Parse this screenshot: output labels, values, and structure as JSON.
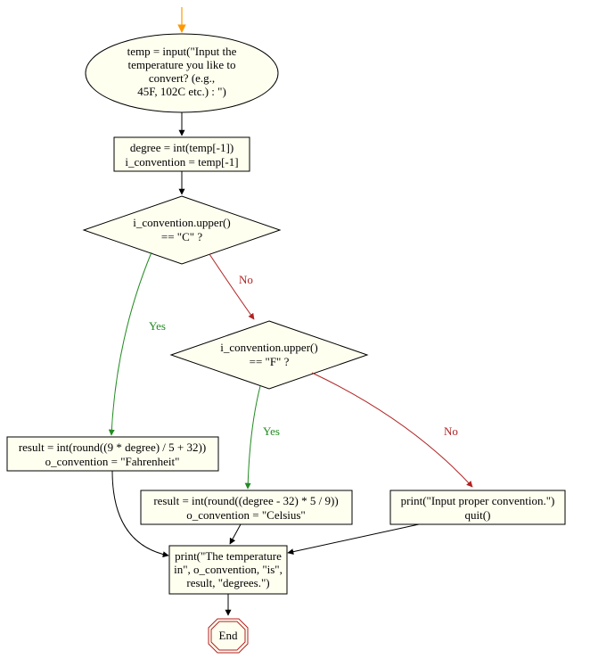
{
  "chart_data": {
    "type": "flowchart",
    "nodes": [
      {
        "id": "start",
        "shape": "point"
      },
      {
        "id": "n1",
        "shape": "ellipse",
        "text": [
          "temp = input(\"Input the",
          "temperature you like to",
          "convert? (e.g.,",
          "45F, 102C etc.) : \")"
        ]
      },
      {
        "id": "n2",
        "shape": "rect",
        "text": [
          "degree = int(temp[-1])",
          "i_convention = temp[-1]"
        ]
      },
      {
        "id": "n3",
        "shape": "diamond",
        "text": [
          "i_convention.upper()",
          "== \"C\" ?"
        ]
      },
      {
        "id": "n4",
        "shape": "diamond",
        "text": [
          "i_convention.upper()",
          "== \"F\" ?"
        ]
      },
      {
        "id": "n5",
        "shape": "rect",
        "text": [
          "result = int(round((9 * degree) / 5 + 32))",
          "o_convention = \"Fahrenheit\""
        ]
      },
      {
        "id": "n6",
        "shape": "rect",
        "text": [
          "result = int(round((degree - 32) * 5 / 9))",
          "o_convention = \"Celsius\""
        ]
      },
      {
        "id": "n7",
        "shape": "rect",
        "text": [
          "print(\"Input proper convention.\")",
          "quit()"
        ]
      },
      {
        "id": "n8",
        "shape": "rect",
        "text": [
          "print(\"The temperature",
          "in\", o_convention, \"is\",",
          "result, \"degrees.\")"
        ]
      },
      {
        "id": "end",
        "shape": "octagon",
        "text": [
          "End"
        ]
      }
    ],
    "edges": [
      {
        "from": "start",
        "to": "n1"
      },
      {
        "from": "n1",
        "to": "n2"
      },
      {
        "from": "n2",
        "to": "n3"
      },
      {
        "from": "n3",
        "to": "n5",
        "label": "Yes"
      },
      {
        "from": "n3",
        "to": "n4",
        "label": "No"
      },
      {
        "from": "n4",
        "to": "n6",
        "label": "Yes"
      },
      {
        "from": "n4",
        "to": "n7",
        "label": "No"
      },
      {
        "from": "n5",
        "to": "n8"
      },
      {
        "from": "n6",
        "to": "n8"
      },
      {
        "from": "n7",
        "to": "n8"
      },
      {
        "from": "n8",
        "to": "end"
      }
    ]
  },
  "labels": {
    "n1_l1": "temp = input(\"Input the",
    "n1_l2": "temperature you like to",
    "n1_l3": "convert? (e.g.,",
    "n1_l4": "45F, 102C etc.) : \")",
    "n2_l1": "degree = int(temp[-1])",
    "n2_l2": "i_convention = temp[-1]",
    "n3_l1": "i_convention.upper()",
    "n3_l2": "== \"C\" ?",
    "n4_l1": "i_convention.upper()",
    "n4_l2": "== \"F\" ?",
    "n5_l1": "result = int(round((9 * degree) / 5 + 32))",
    "n5_l2": "o_convention = \"Fahrenheit\"",
    "n6_l1": "result = int(round((degree - 32) * 5 / 9))",
    "n6_l2": "o_convention = \"Celsius\"",
    "n7_l1": "print(\"Input proper convention.\")",
    "n7_l2": "quit()",
    "n8_l1": "print(\"The temperature",
    "n8_l2": "in\", o_convention, \"is\",",
    "n8_l3": "result, \"degrees.\")",
    "end": "End",
    "yes": "Yes",
    "no": "No"
  }
}
